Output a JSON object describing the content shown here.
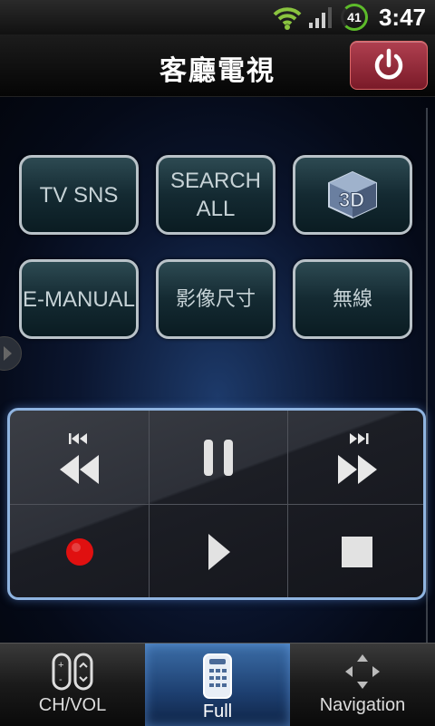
{
  "status_bar": {
    "time": "3:47",
    "battery_level": "41",
    "battery_color": "#5dbb2a",
    "wifi_color": "#8ac43f",
    "icons": [
      "wifi-icon",
      "signal-icon",
      "battery-icon"
    ]
  },
  "header": {
    "title": "客廳電視",
    "power_icon": "power-icon",
    "power_color": "#9b2c3c"
  },
  "grid_buttons": [
    {
      "label": "TV SNS"
    },
    {
      "label": "SEARCH\nALL"
    },
    {
      "label": "",
      "icon": "3d-icon"
    },
    {
      "label": "E-MANUAL"
    },
    {
      "label": "影像尺寸"
    },
    {
      "label": "無線"
    }
  ],
  "media_controls": [
    {
      "name": "rewind",
      "icon": "rewind-icon"
    },
    {
      "name": "pause",
      "icon": "pause-icon"
    },
    {
      "name": "fast-forward",
      "icon": "fast-forward-icon"
    },
    {
      "name": "record",
      "icon": "record-icon",
      "color": "#e01010"
    },
    {
      "name": "play",
      "icon": "play-icon"
    },
    {
      "name": "stop",
      "icon": "stop-icon"
    }
  ],
  "tabs": [
    {
      "label": "CH/VOL",
      "icon": "ch-vol-icon",
      "active": false
    },
    {
      "label": "Full",
      "icon": "remote-icon",
      "active": true
    },
    {
      "label": "Navigation",
      "icon": "navigation-arrows-icon",
      "active": false
    }
  ]
}
